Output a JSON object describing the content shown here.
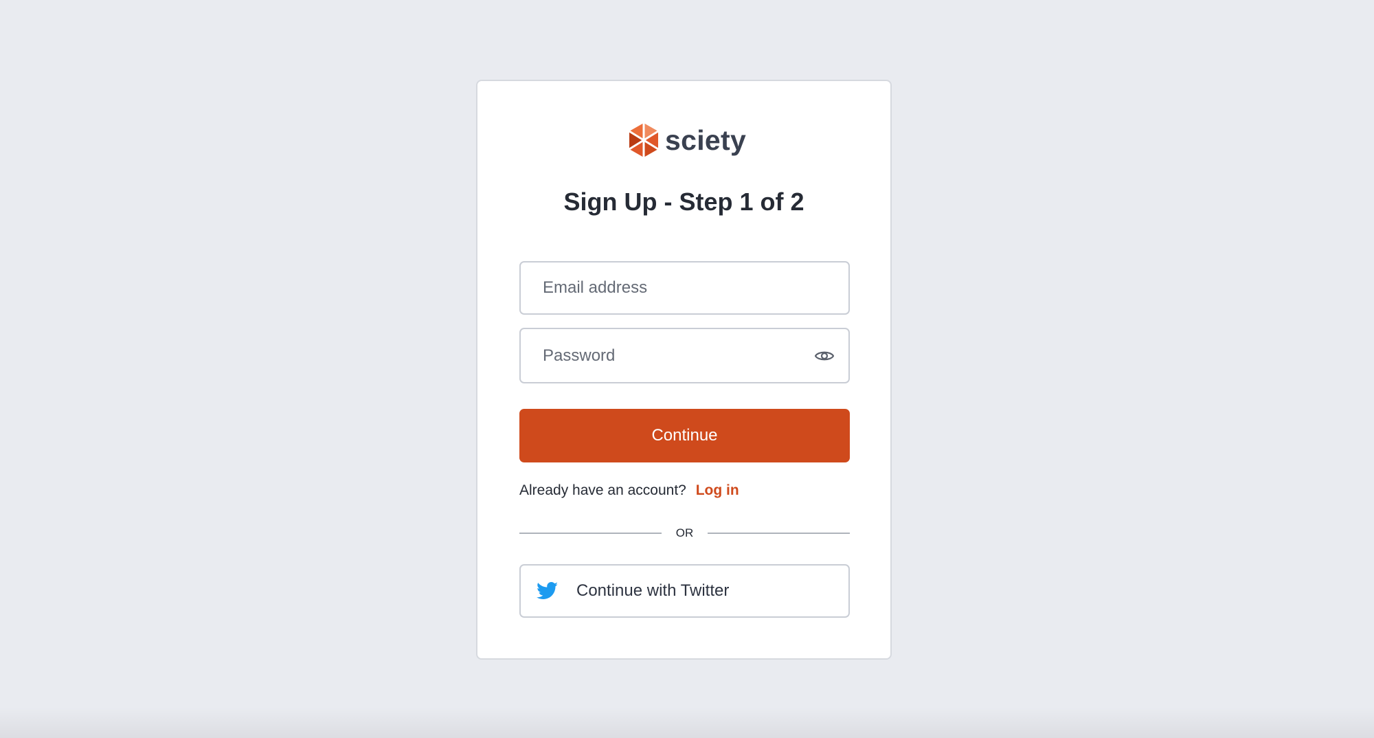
{
  "brand": {
    "name": "sciety",
    "logo_icon": "sciety-hexagon-logo-icon",
    "accent_color": "#cf4a1c"
  },
  "form": {
    "title": "Sign Up - Step 1 of 2",
    "email_placeholder": "Email address",
    "email_value": "",
    "password_placeholder": "Password",
    "password_value": "",
    "password_toggle_icon": "eye-icon",
    "continue_label": "Continue"
  },
  "login": {
    "prompt": "Already have an account?",
    "link_label": "Log in"
  },
  "divider": {
    "label": "OR"
  },
  "social": {
    "twitter_label": "Continue with Twitter",
    "twitter_icon": "twitter-bird-icon",
    "twitter_color": "#1d9bf0"
  }
}
